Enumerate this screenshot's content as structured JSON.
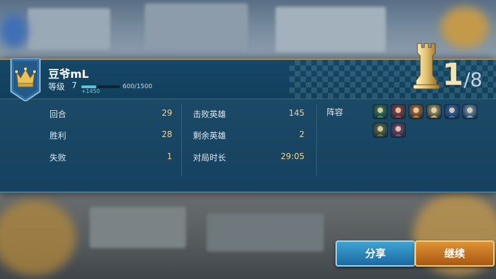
{
  "player": {
    "name": "豆爷mL",
    "level_label": "等级",
    "level": "7",
    "xp_gain": "+1450",
    "xp_progress": "600/1500",
    "xp_fraction": 0.4
  },
  "rank": {
    "place": "1",
    "total": "/8"
  },
  "stats": {
    "rounds_label": "回合",
    "rounds": "29",
    "wins_label": "胜利",
    "wins": "28",
    "losses_label": "失败",
    "losses": "1",
    "heroes_defeated_label": "击败英雄",
    "heroes_defeated": "145",
    "heroes_remaining_label": "剩余英雄",
    "heroes_remaining": "2",
    "duration_label": "对局时长",
    "duration": "29:05"
  },
  "lineup": {
    "label": "阵容",
    "heroes": [
      {
        "icon": "green-dragon-hero-icon",
        "color": "#3c8a55"
      },
      {
        "icon": "red-warrior-hero-icon",
        "color": "#a8443a"
      },
      {
        "icon": "fire-spirit-hero-icon",
        "color": "#d27a2a"
      },
      {
        "icon": "paladin-hero-icon",
        "color": "#c8b36a"
      },
      {
        "icon": "blue-knight-hero-icon",
        "color": "#3c6fb8"
      },
      {
        "icon": "ice-mage-hero-icon",
        "color": "#7fa8c6"
      },
      {
        "icon": "goblin-mech-hero-icon",
        "color": "#6a7c3a"
      },
      {
        "icon": "orc-rider-hero-icon",
        "color": "#8a4d6a"
      }
    ]
  },
  "buttons": {
    "share": "分享",
    "continue": "继续"
  },
  "colors": {
    "panel": "#1a4865",
    "gold_text": "#e9d59a",
    "share": "#1b6aa0",
    "continue": "#a85813"
  }
}
